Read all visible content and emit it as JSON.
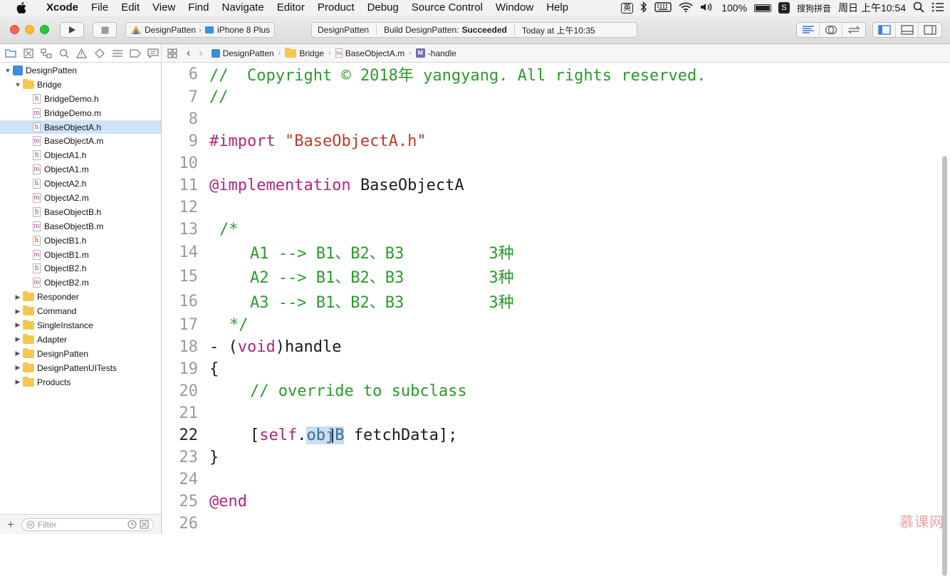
{
  "menubar": {
    "items": [
      "Xcode",
      "File",
      "Edit",
      "View",
      "Find",
      "Navigate",
      "Editor",
      "Product",
      "Debug",
      "Source Control",
      "Window",
      "Help"
    ],
    "status": {
      "ime": "英",
      "battery": "100%",
      "input_method": "搜狗拼音",
      "clock": "周日 上午10:54"
    }
  },
  "toolbar": {
    "scheme": "DesignPatten",
    "device": "iPhone 8 Plus",
    "activity": {
      "project": "DesignPatten",
      "build_label": "Build DesignPatten:",
      "build_status": "Succeeded",
      "time": "Today at 上午10:35"
    }
  },
  "navigator": {
    "filter_placeholder": "Filter",
    "tree": [
      {
        "label": "DesignPatten",
        "kind": "project",
        "indent": 0,
        "open": true
      },
      {
        "label": "Bridge",
        "kind": "folder",
        "indent": 1,
        "open": true
      },
      {
        "label": "BridgeDemo.h",
        "kind": "h",
        "indent": 2
      },
      {
        "label": "BridgeDemo.m",
        "kind": "m",
        "indent": 2
      },
      {
        "label": "BaseObjectA.h",
        "kind": "h",
        "indent": 2,
        "selected": true
      },
      {
        "label": "BaseObjectA.m",
        "kind": "m",
        "indent": 2
      },
      {
        "label": "ObjectA1.h",
        "kind": "h",
        "indent": 2
      },
      {
        "label": "ObjectA1.m",
        "kind": "m",
        "indent": 2
      },
      {
        "label": "ObjectA2.h",
        "kind": "h",
        "indent": 2
      },
      {
        "label": "ObjectA2.m",
        "kind": "m",
        "indent": 2
      },
      {
        "label": "BaseObjectB.h",
        "kind": "h",
        "indent": 2
      },
      {
        "label": "BaseObjectB.m",
        "kind": "m",
        "indent": 2
      },
      {
        "label": "ObjectB1.h",
        "kind": "h",
        "indent": 2
      },
      {
        "label": "ObjectB1.m",
        "kind": "m",
        "indent": 2
      },
      {
        "label": "ObjectB2.h",
        "kind": "h",
        "indent": 2
      },
      {
        "label": "ObjectB2.m",
        "kind": "m",
        "indent": 2
      },
      {
        "label": "Responder",
        "kind": "folder",
        "indent": 1,
        "open": false
      },
      {
        "label": "Command",
        "kind": "folder",
        "indent": 1,
        "open": false
      },
      {
        "label": "SingleInstance",
        "kind": "folder",
        "indent": 1,
        "open": false
      },
      {
        "label": "Adapter",
        "kind": "folder",
        "indent": 1,
        "open": false
      },
      {
        "label": "DesignPatten",
        "kind": "folder",
        "indent": 1,
        "open": false
      },
      {
        "label": "DesignPattenUITests",
        "kind": "folder",
        "indent": 1,
        "open": false
      },
      {
        "label": "Products",
        "kind": "folder",
        "indent": 1,
        "open": false
      }
    ]
  },
  "jumpbar": {
    "project": "DesignPatten",
    "group": "Bridge",
    "file": "BaseObjectA.m",
    "method": "-handle"
  },
  "editor": {
    "current_line": "22",
    "lines": [
      {
        "num": "6"
      },
      {
        "num": "7"
      },
      {
        "num": "8"
      },
      {
        "num": "9"
      },
      {
        "num": "10"
      },
      {
        "num": "11"
      },
      {
        "num": "12"
      },
      {
        "num": "13"
      },
      {
        "num": "14"
      },
      {
        "num": "15"
      },
      {
        "num": "16"
      },
      {
        "num": "17"
      },
      {
        "num": "18"
      },
      {
        "num": "19"
      },
      {
        "num": "20"
      },
      {
        "num": "21"
      },
      {
        "num": "22"
      },
      {
        "num": "23"
      },
      {
        "num": "24"
      },
      {
        "num": "25"
      },
      {
        "num": "26"
      }
    ],
    "code": {
      "l6": "//  Copyright © 2018年 yangyang. All rights reserved.",
      "l7": "//",
      "l9_kw": "#import",
      "l9_str": "\"BaseObjectA.h\"",
      "l11_kw": "@implementation",
      "l11_name": "BaseObjectA",
      "l13": "/*",
      "l14": "A1 --> B1、B2、B3         3种",
      "l15": "A2 --> B1、B2、B3         3种",
      "l16": "A3 --> B1、B2、B3         3种",
      "l17": "*/",
      "l18_a": "- (",
      "l18_kw": "void",
      "l18_b": ")handle",
      "l19": "{",
      "l20": "// override to subclass",
      "l22_a": "[",
      "l22_self": "self",
      "l22_dot": ".",
      "l22_prop": "objB",
      "l22_b": " fetchData];",
      "l23": "}",
      "l25": "@end"
    }
  },
  "watermark": "慕课网"
}
